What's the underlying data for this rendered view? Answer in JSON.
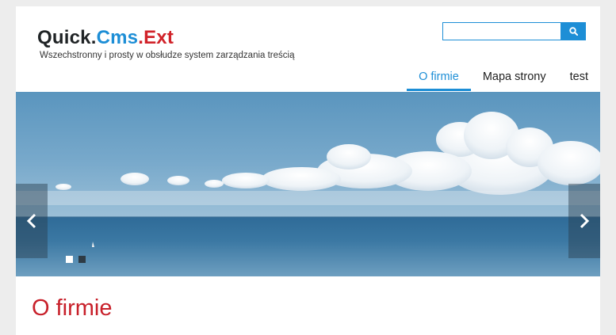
{
  "header": {
    "logo": {
      "part1": "Quick",
      "sep1": ".",
      "part2": "Cms",
      "sep2": ".",
      "part3": "Ext"
    },
    "slogan": "Wszechstronny i prosty w obsłudze system zarządzania treścią"
  },
  "search": {
    "value": "",
    "placeholder": "",
    "icon": "search-icon"
  },
  "nav": {
    "items": [
      {
        "label": "O firmie",
        "active": true
      },
      {
        "label": "Mapa strony",
        "active": false
      },
      {
        "label": "test",
        "active": false
      }
    ]
  },
  "slider": {
    "prev_icon": "chevron-left-icon",
    "next_icon": "chevron-right-icon",
    "slide_count": 2,
    "active_slide": 1
  },
  "content": {
    "title": "O firmie"
  },
  "colors": {
    "brand_blue": "#1d8ed6",
    "brand_red": "#d1232a",
    "title_red": "#c8202a",
    "background": "#ededed"
  }
}
